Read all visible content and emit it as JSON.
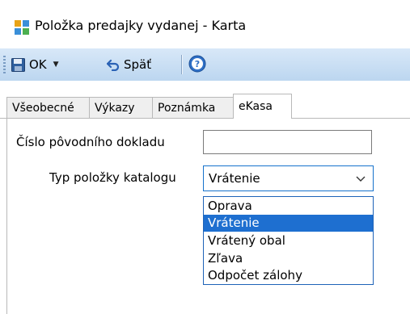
{
  "window": {
    "title": "Položka predajky vydanej - Karta"
  },
  "toolbar": {
    "ok_label": "OK",
    "back_label": "Späť"
  },
  "tabs": [
    {
      "label": "Všeobecné"
    },
    {
      "label": "Výkazy"
    },
    {
      "label": "Poznámka"
    },
    {
      "label": "eKasa"
    }
  ],
  "active_tab": "eKasa",
  "form": {
    "original_doc_label": "Číslo pôvodního dokladu",
    "original_doc_value": "",
    "catalog_type_label": "Typ položky katalogu",
    "catalog_type_value": "Vrátenie"
  },
  "dropdown_options": [
    {
      "label": "Oprava"
    },
    {
      "label": "Vrátenie"
    },
    {
      "label": "Vrátený obal"
    },
    {
      "label": "Zľava"
    },
    {
      "label": "Odpočet zálohy"
    }
  ],
  "selected_option": "Vrátenie",
  "colors": {
    "toolbar_bg": "#c6dcf2",
    "accent": "#1e6fd0",
    "focus_border": "#1672cc"
  }
}
